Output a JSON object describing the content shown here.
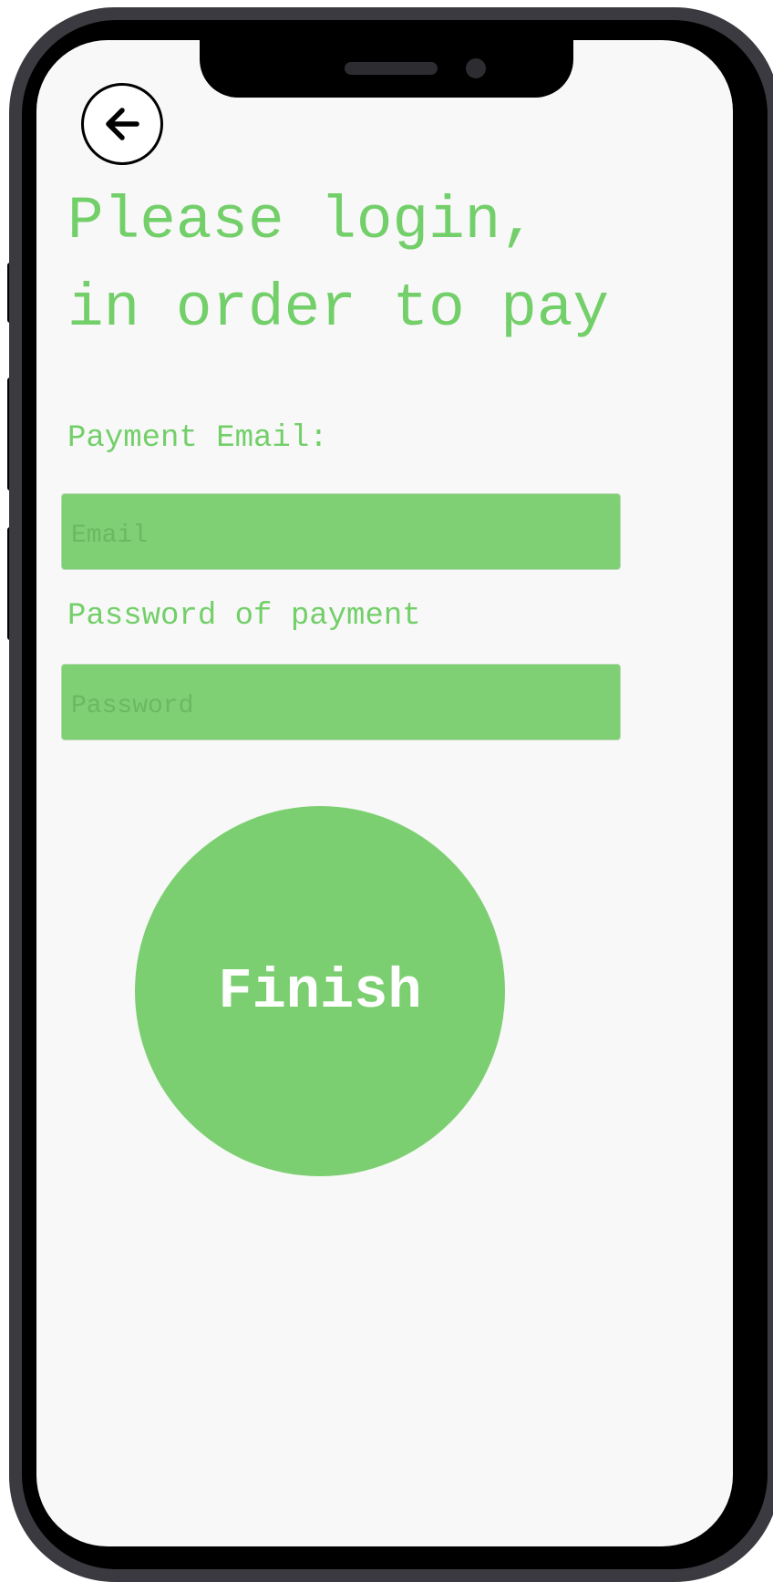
{
  "header": {
    "back_icon": "arrow-left-icon",
    "title_line1": "Please login,",
    "title_line2": "in order to pay"
  },
  "form": {
    "email_label": "Payment Email:",
    "email_placeholder": "Email",
    "email_value": "",
    "password_label": "Password of payment",
    "password_placeholder": "Password",
    "password_value": ""
  },
  "actions": {
    "finish_label": "Finish"
  },
  "colors": {
    "accent_green": "#73cf69",
    "field_green": "#7fcf74",
    "screen_bg": "#f8f8f8",
    "frame": "#3b3a40"
  }
}
